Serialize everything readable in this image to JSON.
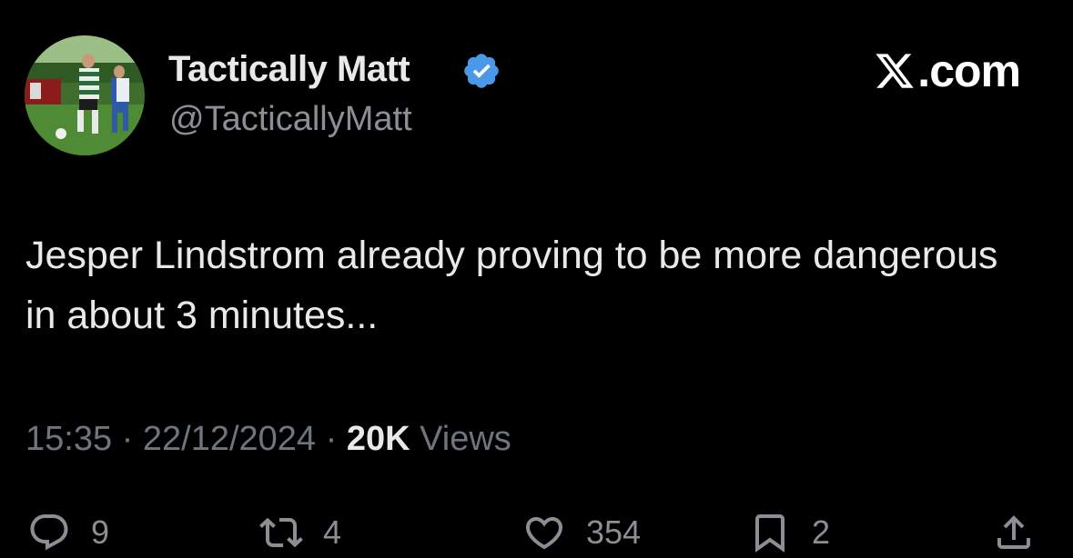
{
  "author": {
    "display_name": "Tactically Matt",
    "handle": "@TacticallyMatt",
    "verified": true,
    "verified_color": "#4a99e9"
  },
  "brand": {
    "suffix": ".com",
    "logo_icon": "x-logo-icon"
  },
  "tweet": {
    "text": "Jesper Lindstrom already proving to be more dangerous in about 3 minutes..."
  },
  "meta": {
    "time": "15:35",
    "separator": "·",
    "date": "22/12/2024",
    "views_count": "20K",
    "views_label": "Views"
  },
  "actions": {
    "replies": "9",
    "reposts": "4",
    "likes": "354",
    "bookmarks": "2"
  },
  "colors": {
    "background": "#000000",
    "primary_text": "#e7e9ea",
    "secondary_text": "#8b8f94",
    "accent": "#4a99e9"
  }
}
